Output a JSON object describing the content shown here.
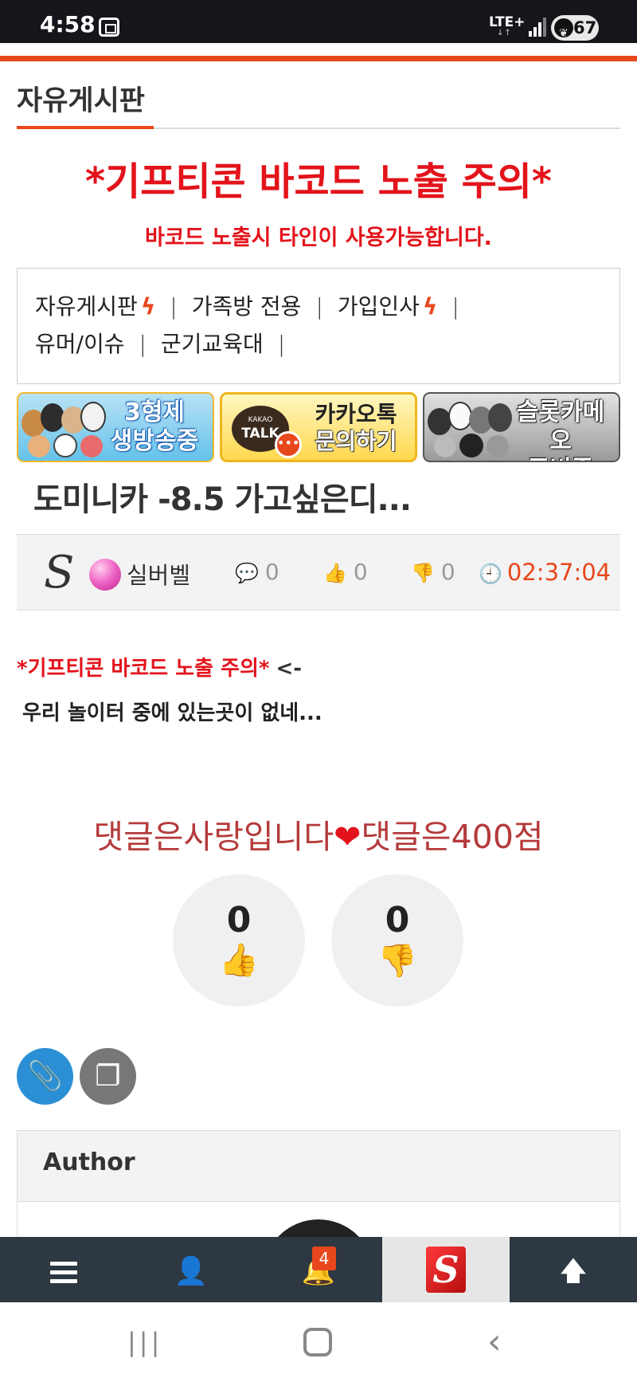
{
  "status_bar": {
    "time": "4:58",
    "network": "LTE+",
    "network_arrows": "↓↑",
    "battery": "67"
  },
  "board": {
    "title": "자유게시판"
  },
  "notice": {
    "title": "*기프티콘 바코드 노출 주의*",
    "subtitle": "바코드 노출시 타인이 사용가능합니다."
  },
  "nav_links": [
    {
      "label": "자유게시판",
      "hot": true
    },
    {
      "label": "가족방 전용",
      "hot": false
    },
    {
      "label": "가입인사",
      "hot": true
    },
    {
      "label": "유머/이슈",
      "hot": false
    },
    {
      "label": "군기교육대",
      "hot": false
    }
  ],
  "nav_separator": "|",
  "hot_icon": "lightning-icon",
  "banners": [
    {
      "line1": "3형제",
      "line2": "생방송중"
    },
    {
      "badge_top": "KAKAO",
      "badge_main": "TALK",
      "line1": "카카오톡",
      "line2": "문의하기"
    },
    {
      "line1": "슬롯카메오",
      "line2": "준비중"
    }
  ],
  "post": {
    "title": "도미니카 -8.5 가고싶은디...",
    "author_logo": "S",
    "author": "실버벨",
    "comments": "0",
    "likes": "0",
    "dislikes": "0",
    "time": "02:37:04",
    "body_link": "*기프티콘 바코드 노출 주의*",
    "body_arrow": "<-",
    "body_text": "우리 놀이터 중에 있는곳이 없네..."
  },
  "promo": {
    "before": "댓글은사랑입니다",
    "heart": "❤",
    "after": "댓글은400점"
  },
  "votes": {
    "up": "0",
    "down": "0"
  },
  "author_section": {
    "label": "Author"
  },
  "bottom_nav": {
    "notifications": "4",
    "logo_letter": "S"
  },
  "colors": {
    "accent": "#e8471c",
    "warning": "#e3131b",
    "promo": "#b53a3a",
    "link_button": "#2b8fd6",
    "nav_bg": "#2e3842"
  }
}
